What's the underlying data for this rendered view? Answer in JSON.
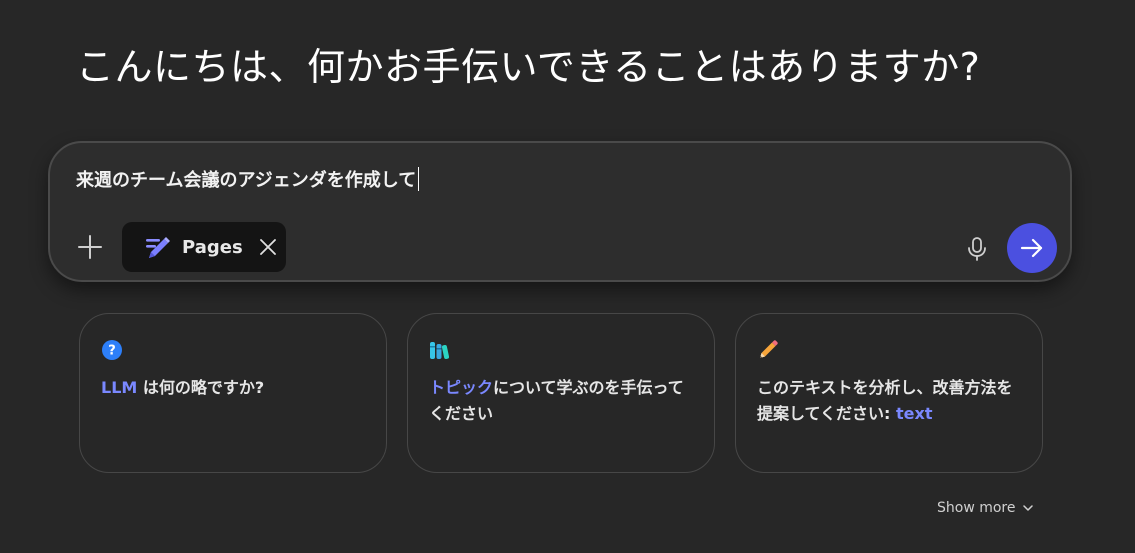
{
  "greeting": "こんにちは、何かお手伝いできることはありますか?",
  "composer": {
    "input_value": "来週のチーム会議のアジェンダを作成して",
    "chip": {
      "label": "Pages",
      "icon": "pages-pen-icon"
    },
    "icons": {
      "add": "plus-icon",
      "remove_chip": "close-icon",
      "voice": "microphone-icon",
      "send": "arrow-right-icon"
    }
  },
  "suggestions": [
    {
      "icon": "question-circle-icon",
      "highlight": "LLM",
      "text": " は何の略ですか?"
    },
    {
      "icon": "books-icon",
      "highlight": "トピック",
      "text": "について学ぶのを手伝ってください"
    },
    {
      "icon": "pencil-icon",
      "text": "このテキストを分析し、改善方法を提案してください: ",
      "highlight": "text"
    }
  ],
  "show_more": {
    "label": "Show more",
    "icon": "chevron-down-icon"
  },
  "colors": {
    "background": "#272727",
    "accent": "#7a88ff",
    "send_button": "#4b50e0",
    "chip_background": "#141414"
  }
}
